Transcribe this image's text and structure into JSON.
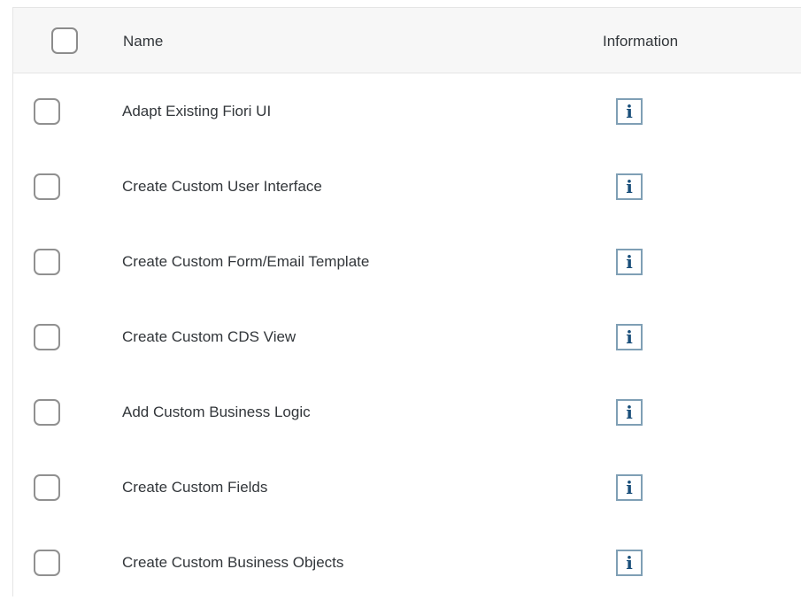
{
  "table": {
    "columns": {
      "name": "Name",
      "information": "Information"
    },
    "rows": [
      {
        "name": "Adapt Existing Fiori UI",
        "info_icon_glyph": "i",
        "icon": "info-icon"
      },
      {
        "name": "Create Custom User Interface",
        "info_icon_glyph": "i",
        "icon": "info-icon"
      },
      {
        "name": "Create Custom Form/Email Template",
        "info_icon_glyph": "i",
        "icon": "info-icon"
      },
      {
        "name": "Create Custom CDS View",
        "info_icon_glyph": "i",
        "icon": "info-icon"
      },
      {
        "name": "Add Custom Business Logic",
        "info_icon_glyph": "i",
        "icon": "info-icon"
      },
      {
        "name": "Create Custom Fields",
        "info_icon_glyph": "i",
        "icon": "info-icon"
      },
      {
        "name": "Create Custom Business Objects",
        "info_icon_glyph": "i",
        "icon": "info-icon"
      }
    ]
  },
  "colors": {
    "header_background": "#f7f7f7",
    "text": "#32363a",
    "checkbox_border": "#909090",
    "info_icon_border": "#7f9fb5",
    "info_icon_glyph": "#1a4f7a"
  }
}
